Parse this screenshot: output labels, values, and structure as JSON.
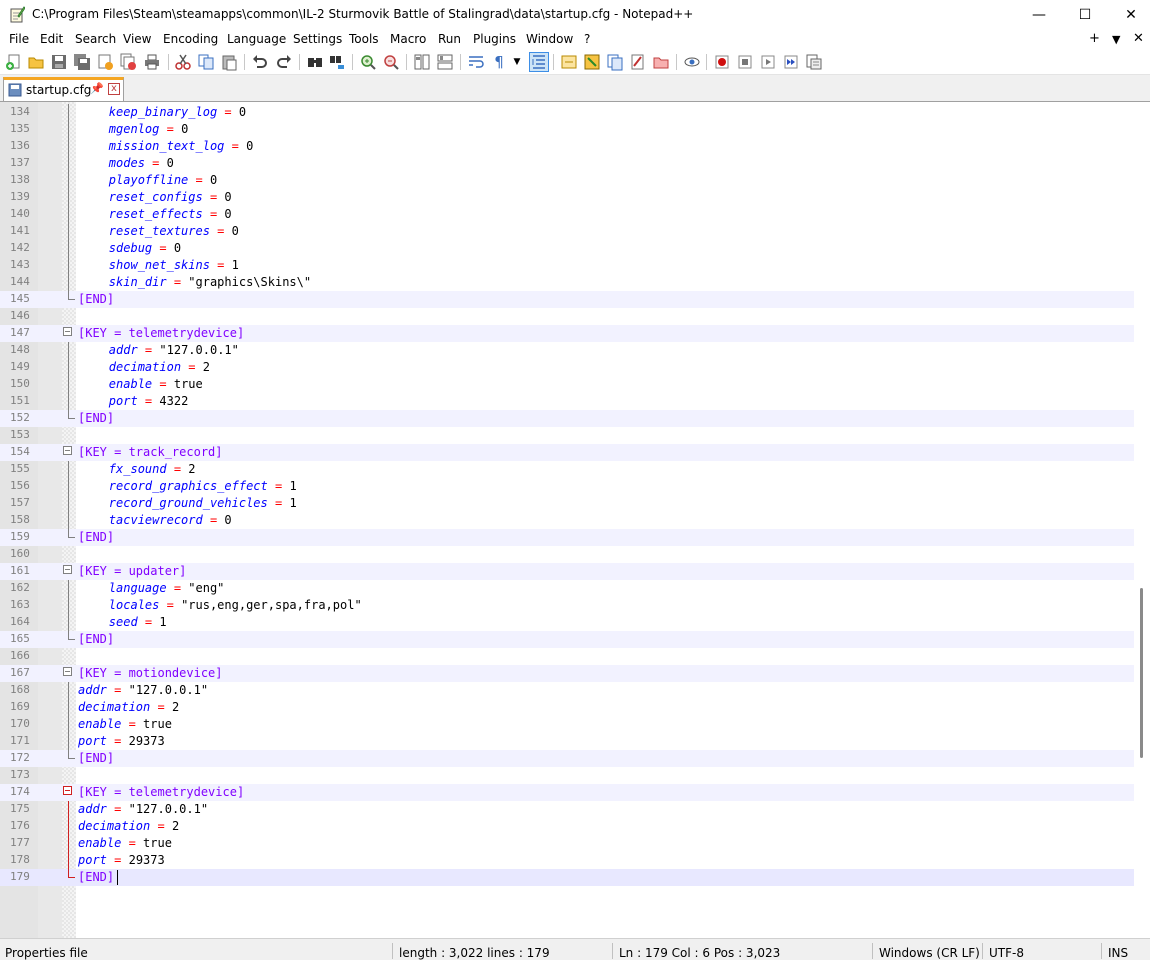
{
  "window": {
    "title": "C:\\Program Files\\Steam\\steamapps\\common\\IL-2 Sturmovik Battle of Stalingrad\\data\\startup.cfg - Notepad++",
    "controls": {
      "minimize": "—",
      "maximize": "☐",
      "close": "✕"
    }
  },
  "menu": {
    "items": [
      "File",
      "Edit",
      "Search",
      "View",
      "Encoding",
      "Language",
      "Settings",
      "Tools",
      "Macro",
      "Run",
      "Plugins",
      "Window",
      "?"
    ],
    "right": {
      "add": "+",
      "dropdown": "▼",
      "close": "✕"
    }
  },
  "toolbar": {
    "buttons": [
      "new-file",
      "open-file",
      "save",
      "save-all",
      "close",
      "close-all",
      "print",
      "cut",
      "copy",
      "paste",
      "undo",
      "redo",
      "find",
      "replace",
      "zoom-in",
      "zoom-out",
      "sync-vertical",
      "sync-horizontal",
      "word-wrap",
      "show-all-chars",
      "indent-guide",
      "user-defined-lang",
      "document-map",
      "function-list",
      "folder-as-workspace",
      "document-list",
      "monitoring",
      "record-macro",
      "stop-recording",
      "play-macro",
      "run-macro-multiple",
      "save-macro"
    ],
    "active": "indent-guide"
  },
  "tab": {
    "label": "startup.cfg",
    "pin": "📌",
    "close": "x"
  },
  "editor": {
    "current_line": 179,
    "lines": [
      {
        "n": "134",
        "indent": 2,
        "key": "keep_binary_log",
        "val": "0"
      },
      {
        "n": "135",
        "indent": 2,
        "key": "mgenlog",
        "val": "0"
      },
      {
        "n": "136",
        "indent": 2,
        "key": "mission_text_log",
        "val": "0"
      },
      {
        "n": "137",
        "indent": 2,
        "key": "modes",
        "val": "0"
      },
      {
        "n": "138",
        "indent": 2,
        "key": "playoffline",
        "val": "0"
      },
      {
        "n": "139",
        "indent": 2,
        "key": "reset_configs",
        "val": "0"
      },
      {
        "n": "140",
        "indent": 2,
        "key": "reset_effects",
        "val": "0"
      },
      {
        "n": "141",
        "indent": 2,
        "key": "reset_textures",
        "val": "0"
      },
      {
        "n": "142",
        "indent": 2,
        "key": "sdebug",
        "val": "0"
      },
      {
        "n": "143",
        "indent": 2,
        "key": "show_net_skins",
        "val": "1"
      },
      {
        "n": "144",
        "indent": 2,
        "key": "skin_dir",
        "val": "\"graphics\\Skins\\\""
      },
      {
        "n": "145",
        "section": "[END]"
      },
      {
        "n": "146"
      },
      {
        "n": "147",
        "section": "[KEY = telemetrydevice]"
      },
      {
        "n": "148",
        "indent": 2,
        "key": "addr",
        "val": "\"127.0.0.1\""
      },
      {
        "n": "149",
        "indent": 2,
        "key": "decimation",
        "val": "2"
      },
      {
        "n": "150",
        "indent": 2,
        "key": "enable",
        "val": "true"
      },
      {
        "n": "151",
        "indent": 2,
        "key": "port",
        "val": "4322"
      },
      {
        "n": "152",
        "section": "[END]"
      },
      {
        "n": "153"
      },
      {
        "n": "154",
        "section": "[KEY = track_record]"
      },
      {
        "n": "155",
        "indent": 2,
        "key": "fx_sound",
        "val": "2"
      },
      {
        "n": "156",
        "indent": 2,
        "key": "record_graphics_effect",
        "val": "1"
      },
      {
        "n": "157",
        "indent": 2,
        "key": "record_ground_vehicles",
        "val": "1"
      },
      {
        "n": "158",
        "indent": 2,
        "key": "tacviewrecord",
        "val": "0"
      },
      {
        "n": "159",
        "section": "[END]"
      },
      {
        "n": "160"
      },
      {
        "n": "161",
        "section": "[KEY = updater]"
      },
      {
        "n": "162",
        "indent": 2,
        "key": "language",
        "val": "\"eng\""
      },
      {
        "n": "163",
        "indent": 2,
        "key": "locales",
        "val": "\"rus,eng,ger,spa,fra,pol\""
      },
      {
        "n": "164",
        "indent": 2,
        "key": "seed",
        "val": "1"
      },
      {
        "n": "165",
        "section": "[END]"
      },
      {
        "n": "166"
      },
      {
        "n": "167",
        "section": "[KEY = motiondevice]"
      },
      {
        "n": "168",
        "indent": 0,
        "key": "addr",
        "val": "\"127.0.0.1\""
      },
      {
        "n": "169",
        "indent": 0,
        "key": "decimation",
        "val": "2"
      },
      {
        "n": "170",
        "indent": 0,
        "key": "enable",
        "val": "true"
      },
      {
        "n": "171",
        "indent": 0,
        "key": "port",
        "val": "29373"
      },
      {
        "n": "172",
        "section": "[END]"
      },
      {
        "n": "173"
      },
      {
        "n": "174",
        "section": "[KEY = telemetrydevice]",
        "highlight_fold": true
      },
      {
        "n": "175",
        "indent": 0,
        "key": "addr",
        "val": "\"127.0.0.1\""
      },
      {
        "n": "176",
        "indent": 0,
        "key": "decimation",
        "val": "2"
      },
      {
        "n": "177",
        "indent": 0,
        "key": "enable",
        "val": "true"
      },
      {
        "n": "178",
        "indent": 0,
        "key": "port",
        "val": "29373"
      },
      {
        "n": "179",
        "section": "[END]"
      }
    ]
  },
  "status": {
    "file_type": "Properties file",
    "length": "length : 3,022    lines : 179",
    "position": "Ln : 179    Col : 6    Pos : 3,023",
    "eol": "Windows (CR LF)",
    "encoding": "UTF-8",
    "mode": "INS"
  },
  "colors": {
    "key": "#0000ff",
    "operator": "#ff0000",
    "section": "#8000ff",
    "tab_accent": "#f5a623",
    "fold_active": "#d02020"
  }
}
